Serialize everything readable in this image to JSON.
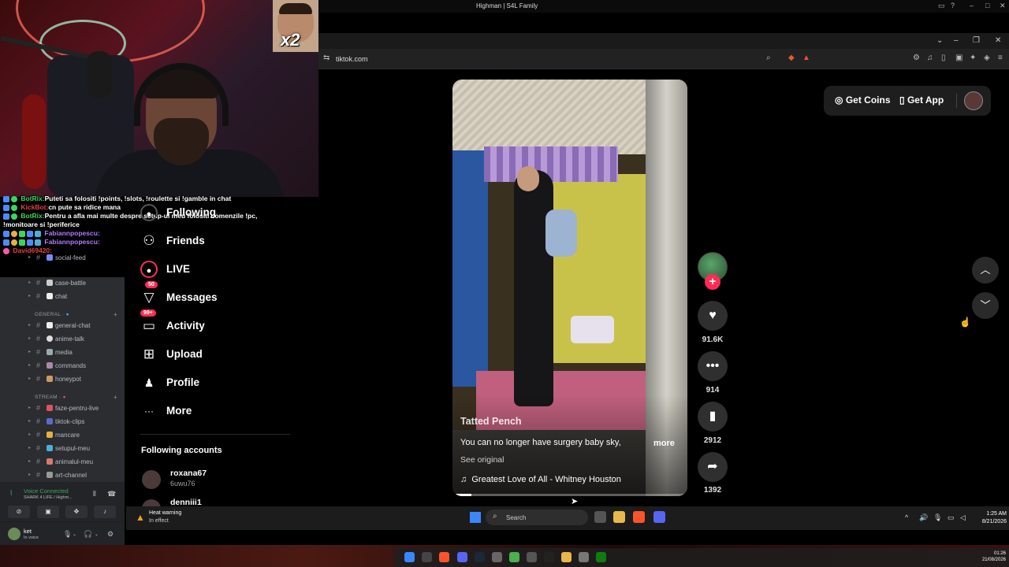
{
  "window": {
    "title": "Highman | S4L Family",
    "url": "tiktok.com"
  },
  "webcam": {
    "badge_text": "x2"
  },
  "chat": [
    {
      "user": "BotRix:",
      "text": "Puteti sa folositi !points, !slots, !roulette si !gamble in chat",
      "color": "#3bd65a"
    },
    {
      "user": "KickBot:",
      "text": "cn pute sa ridice mana",
      "color": "#e83c3c"
    },
    {
      "user": "BotRix:",
      "text": "Pentru a afla mai multe despre setup-ul meu folositi comenzile !pc, !monitoare si !periferice",
      "color": "#3bd65a"
    },
    {
      "user": "Fabiannpopescu:",
      "text": "",
      "color": "#b07aff"
    },
    {
      "user": "Fabiannpopescu:",
      "text": "",
      "color": "#b07aff"
    },
    {
      "user": "David69420:",
      "text": "",
      "color": "#ff5aa0"
    }
  ],
  "discord": {
    "channels_top": [
      "social-feed",
      "case-battle",
      "chat"
    ],
    "category_general": "GENERAL",
    "channels_general": [
      "general-chat",
      "anime-talk",
      "media",
      "commands",
      "honeypot"
    ],
    "category_stream": "STREAM",
    "channels_stream": [
      "faze-pentru-live",
      "tiktok-clips",
      "mancare",
      "setupul-meu",
      "animalul-meu",
      "art-channel"
    ],
    "voice_status": "Voice Connected",
    "voice_channel": "SHARK 4 LIFE / Highm...",
    "username": "ket",
    "user_status": "In voice"
  },
  "nav": {
    "following": "Following",
    "friends": "Friends",
    "live": "LIVE",
    "messages": "Messages",
    "messages_badge": "50",
    "activity": "Activity",
    "activity_badge": "99+",
    "upload": "Upload",
    "profile": "Profile",
    "more": "More"
  },
  "following_accounts": {
    "title": "Following accounts",
    "items": [
      {
        "username": "roxana67",
        "display": "6uwu76"
      },
      {
        "username": "denniii1",
        "display": ""
      }
    ]
  },
  "header": {
    "get_coins": "Get Coins",
    "get_app": "Get App"
  },
  "video": {
    "author": "Tatted Pench",
    "description": "You can no longer have surgery baby sky,",
    "more": "more",
    "see_original": "See original",
    "music": "Greatest Love of All - Whitney Houston",
    "progress": 0.08
  },
  "actions": {
    "likes": "91.6K",
    "comments": "914",
    "saves": "2912",
    "shares": "1392"
  },
  "taskbar": {
    "weather_title": "Heat warning",
    "weather_sub": "In effect",
    "search_placeholder": "Search",
    "time": "1:25 AM",
    "date": "8/21/2026",
    "bottom_time": "01:26",
    "bottom_date": "21/08/2026"
  },
  "colors": {
    "accent": "#fe2c55",
    "discord_bg": "#2b2d31",
    "voice_green": "#3ba55d"
  }
}
